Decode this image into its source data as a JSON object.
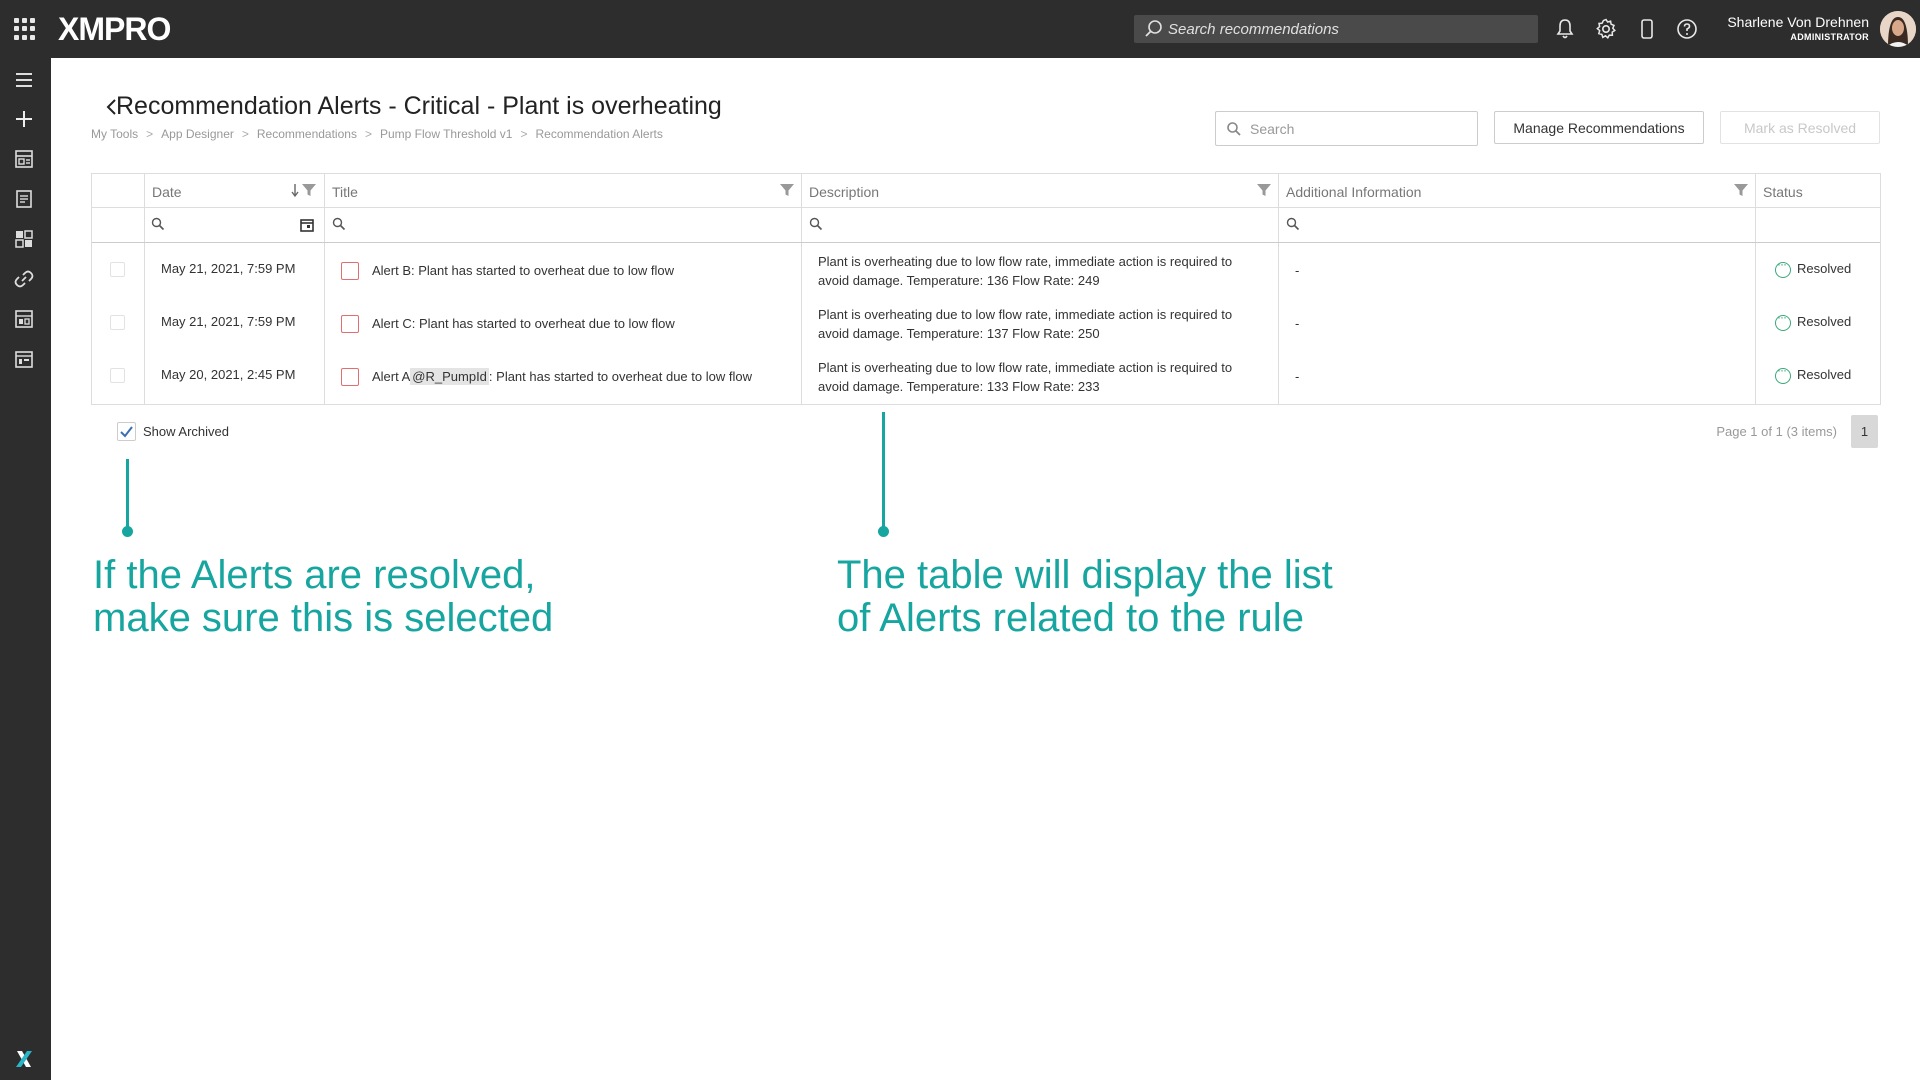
{
  "topbar": {
    "logo": "XMPRO",
    "search_placeholder": "Search recommendations",
    "user_name": "Sharlene Von Drehnen",
    "user_role": "ADMINISTRATOR",
    "icons": [
      "apps-grid-icon",
      "bell-icon",
      "gear-icon",
      "mobile-icon",
      "help-icon"
    ]
  },
  "sidebar": {
    "icons": [
      "menu-icon",
      "plus-icon",
      "app-designer-icon",
      "recommendations-icon",
      "dashboard-icon",
      "link-icon",
      "data-stream-icon",
      "calendar-icon",
      "xmpro-x-icon"
    ]
  },
  "header": {
    "title": "Recommendation Alerts - Critical - Plant is overheating",
    "breadcrumb": [
      "My Tools",
      "App Designer",
      "Recommendations",
      "Pump Flow Threshold v1",
      "Recommendation Alerts"
    ],
    "search_placeholder": "Search",
    "manage_button": "Manage Recommendations",
    "resolve_button": "Mark as Resolved"
  },
  "table": {
    "columns": [
      "Date",
      "Title",
      "Description",
      "Additional Information",
      "Status"
    ],
    "rows": [
      {
        "date": "May 21, 2021, 7:59 PM",
        "title": "Alert B: Plant has started to overheat due to low flow",
        "description_line1": "Plant is overheating due to low flow rate, immediate action is required to",
        "description_line2": "avoid damage. Temperature: 136 Flow Rate: 249",
        "additional": "-",
        "status": "Resolved"
      },
      {
        "date": "May 21, 2021, 7:59 PM",
        "title": "Alert C: Plant has started to overheat due to low flow",
        "description_line1": "Plant is overheating due to low flow rate, immediate action is required to",
        "description_line2": "avoid damage. Temperature: 137 Flow Rate: 250",
        "additional": "-",
        "status": "Resolved"
      },
      {
        "date": "May 20, 2021, 2:45 PM",
        "title_prefix": "Alert A",
        "title_tag": "@R_PumpId",
        "title_suffix": ": Plant has started to overheat due to low flow",
        "description_line1": "Plant is overheating due to low flow rate, immediate action is required to",
        "description_line2": "avoid damage. Temperature: 133 Flow Rate: 233",
        "additional": "-",
        "status": "Resolved"
      }
    ]
  },
  "footer": {
    "show_archived_label": "Show Archived",
    "show_archived_checked": true,
    "page_info": "Page 1 of 1 (3 items)",
    "page_number": "1"
  },
  "annotations": {
    "left_line1": "If the Alerts are resolved,",
    "left_line2": "make sure this is selected",
    "right_line1": "The table will display the list",
    "right_line2": "of Alerts related to the rule"
  },
  "colors": {
    "topbar_bg": "#2d2d2d",
    "annotation": "#17a5a0",
    "status_green": "#3aaa7a",
    "alert_red": "#e07070"
  }
}
